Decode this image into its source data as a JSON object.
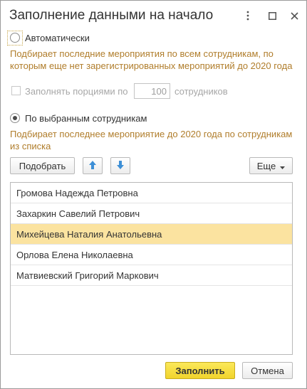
{
  "window": {
    "title": "Заполнение данными на начало",
    "icons": [
      "more-vertical-icon",
      "maximize-icon",
      "close-icon"
    ]
  },
  "options": {
    "auto": {
      "label": "Автоматически",
      "hint": "Подбирает последние мероприятия по всем сотрудникам, по которым еще нет зарегистрированных мероприятий до 2020 года",
      "checked": false
    },
    "portions": {
      "label": "Заполнять порциями по",
      "value": "100",
      "suffix": "сотрудников",
      "checked": false
    },
    "selected": {
      "label": "По выбранным сотрудникам",
      "hint": "Подбирает последнее мероприятие до 2020 года по сотрудникам из списка",
      "checked": true
    }
  },
  "toolbar": {
    "pick_label": "Подобрать",
    "more_label": "Еще",
    "move_up_icon": "arrow-up-icon",
    "move_down_icon": "arrow-down-icon"
  },
  "employees": [
    "Громова Надежда Петровна",
    "Захаркин Савелий Петрович",
    "Михейцева Наталия Анатольевна",
    "Орлова Елена Николаевна",
    "Матвиевский Григорий Маркович"
  ],
  "selected_employee_index": 2,
  "footer": {
    "fill_label": "Заполнить",
    "cancel_label": "Отмена"
  },
  "colors": {
    "hint": "#b07d2b",
    "arrow": "#3d8fd6",
    "primary": "#f5dd3e",
    "selection": "#fbe3a0"
  }
}
